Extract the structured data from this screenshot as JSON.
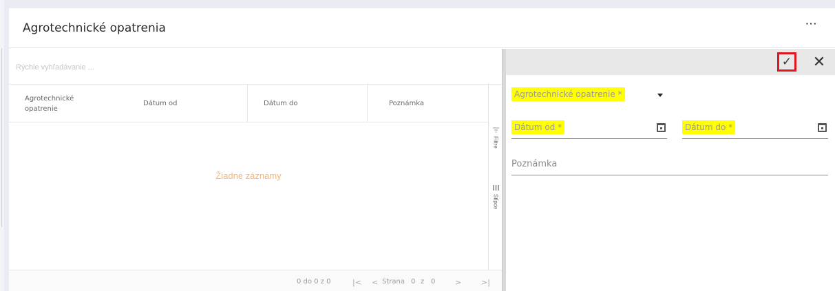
{
  "page": {
    "title": "Agrotechnické opatrenia",
    "more_label": "···"
  },
  "grid": {
    "search_placeholder": "Rýchle vyhľadávanie ...",
    "columns": [
      "Agrotechnické opatrenie",
      "Dátum od",
      "Dátum do",
      "Poznámka"
    ],
    "empty_text": "Žiadne záznamy",
    "side_panel": {
      "filters_label": "Filtre",
      "columns_label": "Stĺpce"
    },
    "footer": {
      "range_text": "0 do 0 z 0",
      "first_icon": "|<",
      "prev_icon": "<",
      "page_label": "Strana",
      "page_current": "0",
      "of_label": "z",
      "page_total": "0",
      "next_icon": ">",
      "last_icon": ">|"
    }
  },
  "detail": {
    "save_icon": "✓",
    "close_icon": "✕",
    "fields": {
      "measure": {
        "label": "Agrotechnické opatrenie *",
        "value": ""
      },
      "date_from": {
        "label": "Dátum od *",
        "value": ""
      },
      "date_to": {
        "label": "Dátum do *",
        "value": ""
      },
      "note": {
        "label": "Poznámka",
        "value": ""
      }
    },
    "highlight_color": "#ffff00",
    "save_outline_color": "#e0161e"
  }
}
